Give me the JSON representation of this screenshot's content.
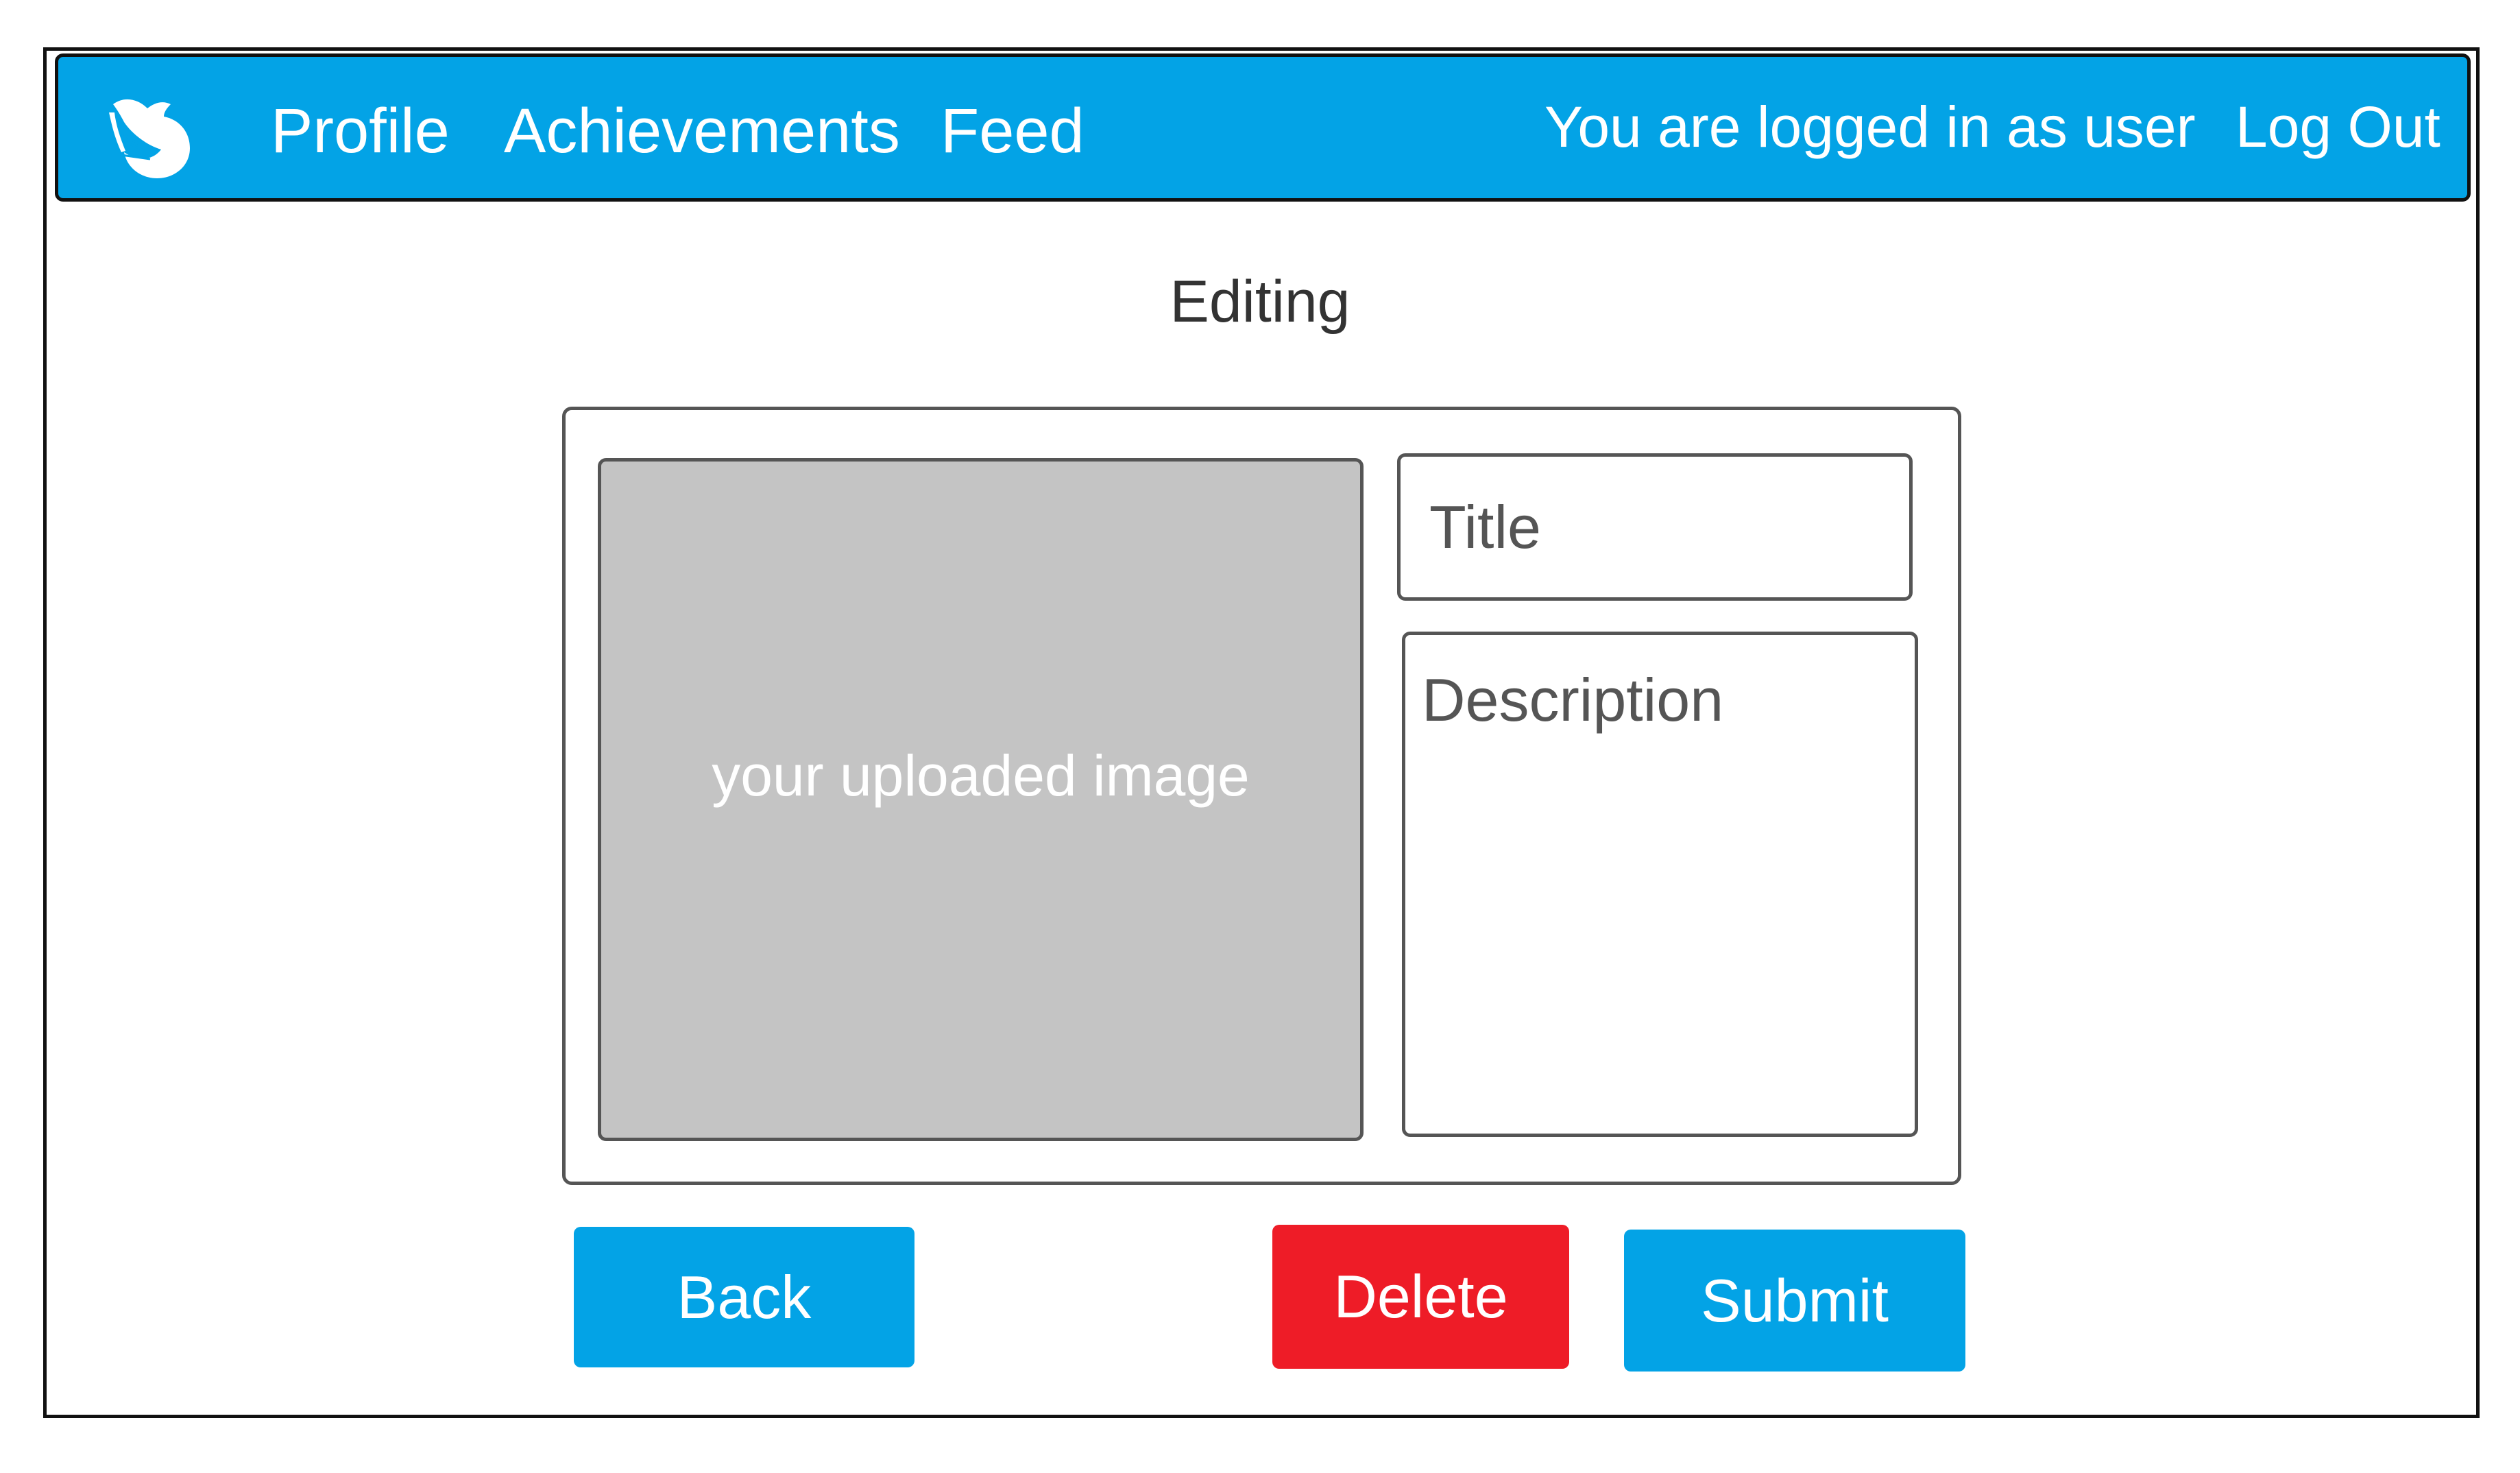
{
  "nav": {
    "links": [
      {
        "label": "Profile"
      },
      {
        "label": "Achievements"
      },
      {
        "label": "Feed"
      }
    ],
    "status": "You are logged in as user",
    "logout": "Log Out"
  },
  "page": {
    "title": "Editing"
  },
  "editor": {
    "image_placeholder": "your uploaded image",
    "title_placeholder": "Title",
    "description_placeholder": "Description"
  },
  "actions": {
    "back": "Back",
    "delete": "Delete",
    "submit": "Submit"
  },
  "colors": {
    "primary": "#03a3e6",
    "danger": "#ee1c27",
    "image_placeholder": "#c4c4c4",
    "border": "#555555"
  },
  "icons": {
    "logo": "bird-logo-icon"
  }
}
